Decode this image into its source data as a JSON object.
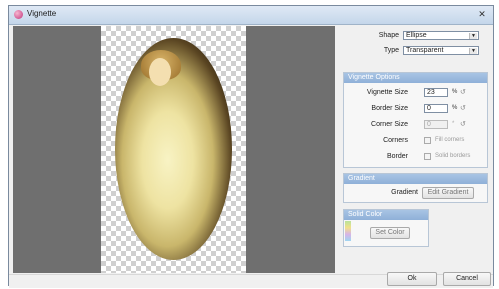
{
  "window": {
    "title": "Vignette",
    "close_glyph": "✕"
  },
  "controls": {
    "shape": {
      "label": "Shape",
      "value": "Ellipse"
    },
    "type": {
      "label": "Type",
      "value": "Transparent"
    }
  },
  "vignette_options": {
    "header": "Vignette Options",
    "vignette_size": {
      "label": "Vignette Size",
      "value": "23",
      "unit": "%"
    },
    "border_size": {
      "label": "Border Size",
      "value": "0",
      "unit": "%"
    },
    "corner_size": {
      "label": "Corner Size",
      "value": "0",
      "unit": "*"
    },
    "corners": {
      "label": "Corners",
      "checkbox_label": "Fill corners"
    },
    "border": {
      "label": "Border",
      "checkbox_label": "Solid borders"
    }
  },
  "gradient": {
    "header": "Gradient",
    "label": "Gradient",
    "button": "Edit Gradient"
  },
  "solid_color": {
    "header": "Solid Color",
    "button": "Set Color"
  },
  "footer": {
    "ok": "Ok",
    "cancel": "Cancel"
  },
  "icons": {
    "reset": "reset-icon",
    "dropdown": "chevron-down-icon",
    "app": "vignette-app-icon"
  }
}
